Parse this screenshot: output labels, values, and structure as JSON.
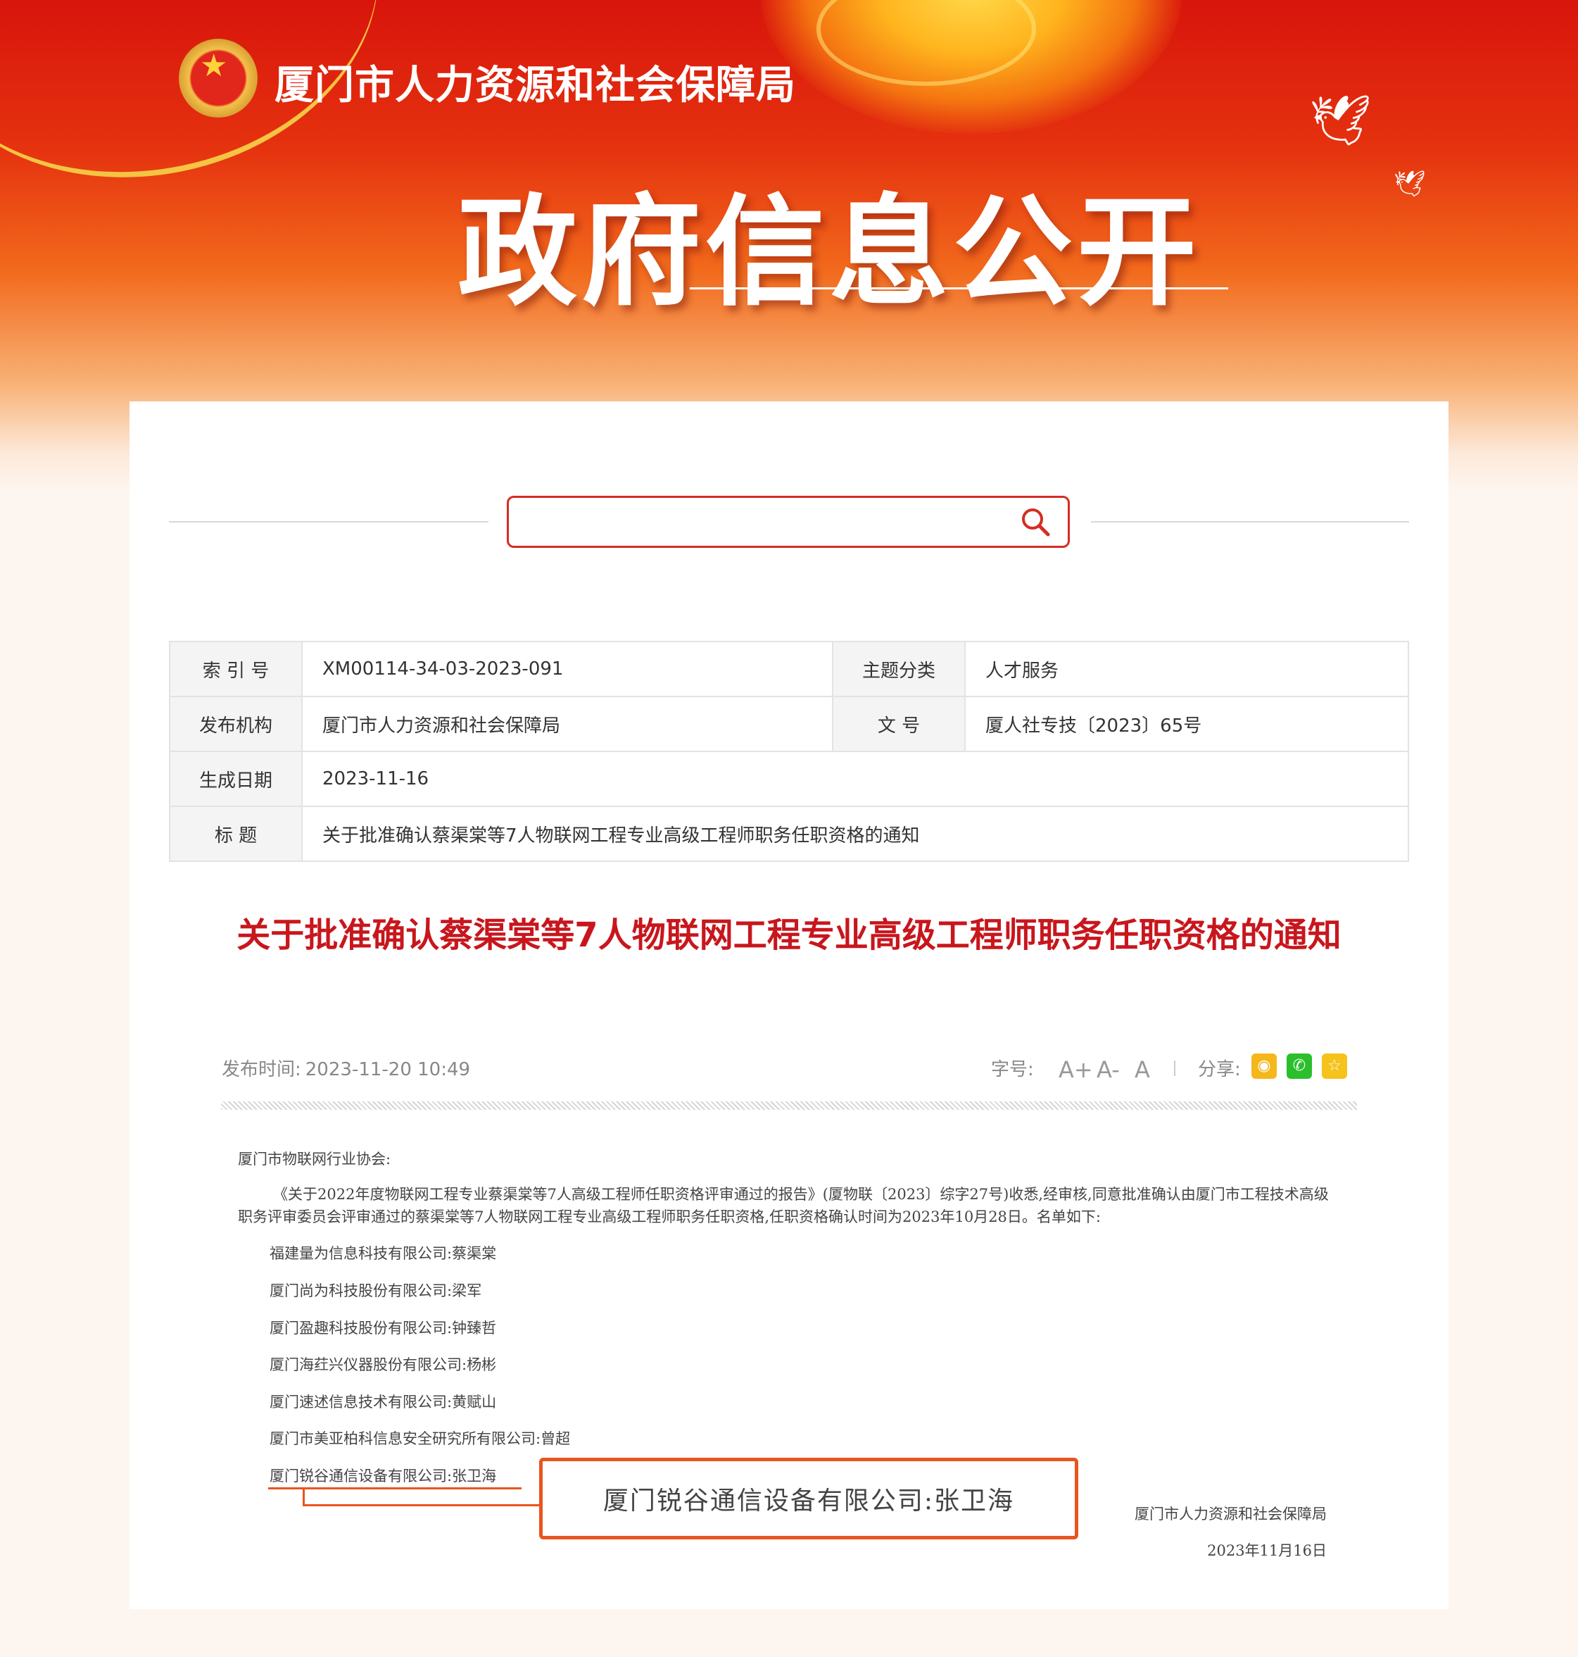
{
  "header": {
    "agency_name": "厦门市人力资源和社会保障局",
    "section_title": "政府信息公开"
  },
  "search": {
    "placeholder": ""
  },
  "meta": {
    "index_label": "索 引 号",
    "index_value": "XM00114-34-03-2023-091",
    "topic_label": "主题分类",
    "topic_value": "人才服务",
    "issuer_label": "发布机构",
    "issuer_value": "厦门市人力资源和社会保障局",
    "docno_label": "文  号",
    "docno_value": "厦人社专技〔2023〕65号",
    "date_label": "生成日期",
    "date_value": "2023-11-16",
    "title_label": "标  题",
    "title_value": "关于批准确认蔡渠棠等7人物联网工程专业高级工程师职务任职资格的通知"
  },
  "article": {
    "title": "关于批准确认蔡渠棠等7人物联网工程专业高级工程师职务任职资格的通知",
    "pub_label": "发布时间:",
    "pub_time": "2023-11-20 10:49",
    "font_label": "字号:",
    "font_large": "A+",
    "font_small": "A-",
    "font_normal": "A",
    "share_label": "分享:",
    "salutation": "厦门市物联网行业协会:",
    "paragraph": "《关于2022年度物联网工程专业蔡渠棠等7人高级工程师任职资格评审通过的报告》(厦物联〔2023〕综字27号)收悉,经审核,同意批准确认由厦门市工程技术高级职务评审委员会评审通过的蔡渠棠等7人物联网工程专业高级工程师职务任职资格,任职资格确认时间为2023年10月28日。名单如下:",
    "entries": [
      "福建量为信息科技有限公司:蔡渠棠",
      "厦门尚为科技股份有限公司:梁军",
      "厦门盈趣科技股份有限公司:钟臻哲",
      "厦门海荭兴仪器股份有限公司:杨彬",
      "厦门速述信息技术有限公司:黄赋山",
      "厦门市美亚柏科信息安全研究所有限公司:曾超",
      "厦门锐谷通信设备有限公司:张卫海"
    ],
    "callout": "厦门锐谷通信设备有限公司:张卫海",
    "signature": "厦门市人力资源和社会保障局",
    "sign_date": "2023年11月16日"
  },
  "colors": {
    "accent_red": "#c8161d",
    "highlight_orange": "#e8551e"
  },
  "icons": [
    "national-emblem",
    "dove",
    "search-icon",
    "weibo-icon",
    "wechat-icon",
    "favorite-icon"
  ]
}
